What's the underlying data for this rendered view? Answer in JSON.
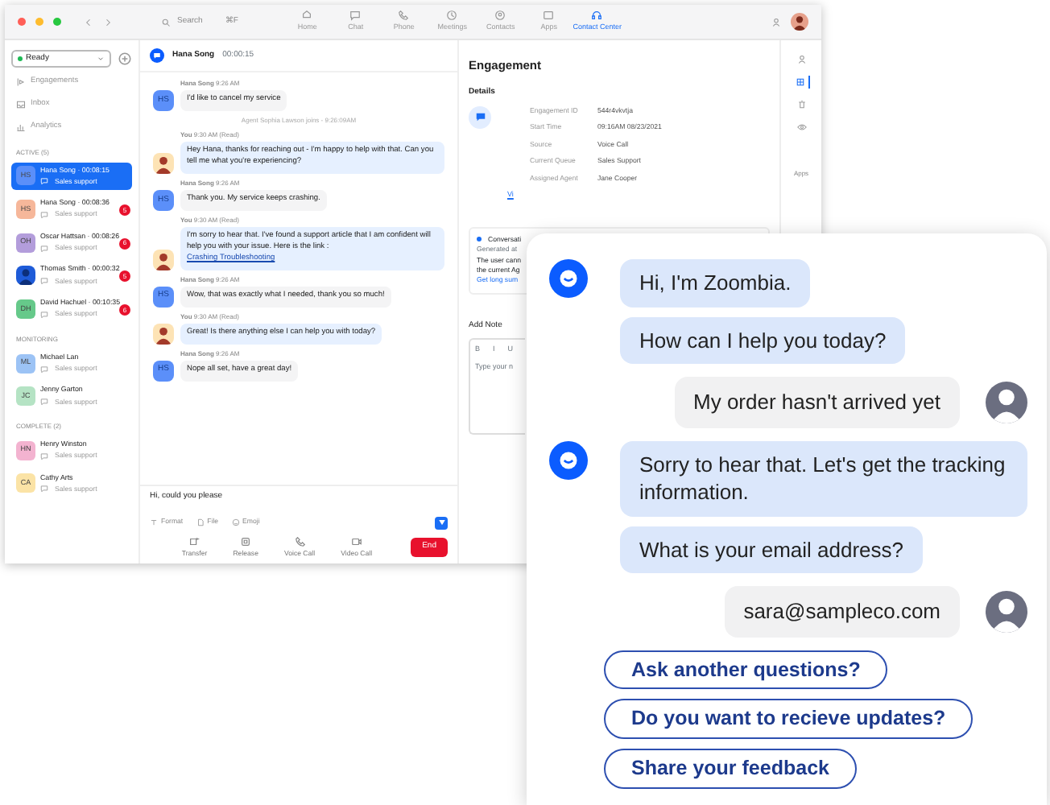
{
  "titlebar": {
    "search": "Search",
    "shortcut": "⌘F",
    "nav": [
      {
        "label": "Home",
        "selected": false
      },
      {
        "label": "Chat",
        "selected": false
      },
      {
        "label": "Phone",
        "selected": false
      },
      {
        "label": "Meetings",
        "selected": false
      },
      {
        "label": "Contacts",
        "selected": false
      },
      {
        "label": "Apps",
        "selected": false
      },
      {
        "label": "Contact Center",
        "selected": true
      }
    ]
  },
  "sidebar": {
    "status": "Ready",
    "menu": [
      "Engagements",
      "Inbox",
      "Analytics"
    ],
    "sections": [
      {
        "title": "ACTIVE (5)",
        "items": [
          {
            "name": "Hana Song · 00:08:15",
            "queue": "Sales support",
            "initials": "HS",
            "color": "#5b8ff9",
            "selected": true
          },
          {
            "name": "Hana Song · 00:08:36",
            "queue": "Sales support",
            "initials": "HS",
            "color": "#f6b79a",
            "badge": "5",
            "selected": false
          },
          {
            "name": "Oscar Hattsan · 00:08:26",
            "queue": "Sales support",
            "initials": "OH",
            "color": "#b39ddb",
            "badge": "6",
            "selected": false
          },
          {
            "name": "Thomas Smith · 00:00:32",
            "queue": "Sales support",
            "color": "#1e5bd8",
            "badge": "5",
            "selected": false
          },
          {
            "name": "David Hachuel · 00:10:35",
            "queue": "Sales support",
            "initials": "DH",
            "color": "#66c98a",
            "badge": "6",
            "selected": false
          }
        ]
      },
      {
        "title": "MONITORING",
        "items": [
          {
            "name": "Michael Lan",
            "queue": "Sales support",
            "initials": "ML",
            "color": "#9cc3f5",
            "selected": false
          },
          {
            "name": "Jenny Garton",
            "queue": "Sales support",
            "initials": "JC",
            "color": "#b5e3c4",
            "selected": false
          }
        ]
      },
      {
        "title": "COMPLETE (2)",
        "items": [
          {
            "name": "Henry Winston",
            "queue": "Sales support",
            "initials": "HN",
            "color": "#f3b3d0",
            "selected": false
          },
          {
            "name": "Cathy Arts",
            "queue": "Sales support",
            "initials": "CA",
            "color": "#fbe3a6",
            "selected": false
          }
        ]
      }
    ]
  },
  "chat": {
    "name": "Hana Song",
    "timer": "00:00:15",
    "messages": [
      {
        "kind": "customer",
        "sender": "Hana Song",
        "time": "9:26 AM",
        "initials": "HS",
        "text": "I'd like to cancel my service"
      },
      {
        "kind": "system",
        "text": "Agent Sophia Lawson joins - 9:26:09AM"
      },
      {
        "kind": "agent",
        "sender": "You",
        "time": "9:30 AM (Read)",
        "text": "Hey Hana, thanks for reaching out - I'm happy to help with that. Can you tell me what you're experiencing?"
      },
      {
        "kind": "customer",
        "sender": "Hana Song",
        "time": "9:26 AM",
        "initials": "HS",
        "text": "Thank you. My service keeps crashing."
      },
      {
        "kind": "agent",
        "sender": "You",
        "time": "9:30 AM (Read)",
        "text": "I'm sorry to hear that. I've found a support article that I am confident will help you with your issue. Here is the link :",
        "link": "Crashing Troubleshooting"
      },
      {
        "kind": "customer",
        "sender": "Hana Song",
        "time": "9:26 AM",
        "initials": "HS",
        "text": "Wow, that was exactly what I needed, thank you so much!"
      },
      {
        "kind": "agent",
        "sender": "You",
        "time": "9:30 AM (Read)",
        "text": "Great! Is there anything else I can help you with today?"
      },
      {
        "kind": "customer",
        "sender": "Hana Song",
        "time": "9:26 AM",
        "initials": "HS",
        "text": "Nope all set, have a great day!"
      }
    ],
    "composer": {
      "value": "Hi, could you please",
      "tools": [
        "Format",
        "File",
        "Emoji"
      ]
    },
    "actions": [
      "Transfer",
      "Release",
      "Voice Call",
      "Video Call"
    ],
    "end": "End"
  },
  "engagement": {
    "title": "Engagement",
    "details_title": "Details",
    "details": [
      {
        "label": "Engagement ID",
        "value": "544r4vkvtja"
      },
      {
        "label": "Start Time",
        "value": "09:16AM 08/23/2021"
      },
      {
        "label": "Source",
        "value": "Voice Call"
      },
      {
        "label": "Current Queue",
        "value": "Sales Support"
      },
      {
        "label": "Assigned Agent",
        "value": "Jane Cooper"
      }
    ],
    "more_link": "Vi",
    "summary": {
      "title": "Conversati",
      "generated": "Generated at",
      "lines": [
        "The user cann",
        "the current Ag"
      ],
      "link": "Get long sum"
    },
    "note": {
      "title": "Add Note",
      "tools": [
        "B",
        "I",
        "U"
      ],
      "placeholder": "Type your n"
    }
  },
  "side_strip": {
    "icons": [
      {
        "selected": false
      },
      {
        "selected": true
      },
      {
        "selected": false
      },
      {
        "selected": false
      }
    ],
    "label": "Apps"
  },
  "bot_chat": {
    "messages": [
      {
        "kind": "bot",
        "bubbles": [
          "Hi, I'm Zoombia.",
          "How can I help you today?"
        ]
      },
      {
        "kind": "user",
        "bubbles": [
          "My order hasn't arrived yet"
        ]
      },
      {
        "kind": "bot",
        "bubbles": [
          "Sorry to hear that. Let's get the tracking information.",
          "What is your email address?"
        ]
      },
      {
        "kind": "user",
        "bubbles": [
          "sara@sampleco.com"
        ]
      }
    ],
    "options": [
      "Ask another questions?",
      "Do you want to recieve updates?",
      "Share your feedback"
    ]
  }
}
